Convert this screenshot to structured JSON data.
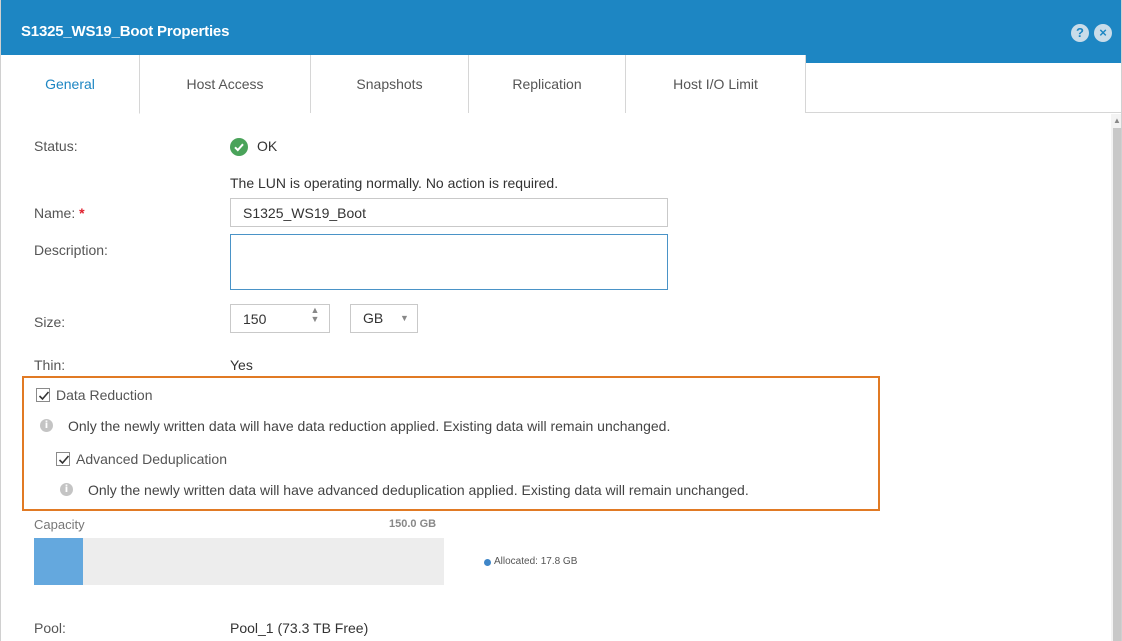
{
  "window": {
    "title": "S1325_WS19_Boot Properties",
    "help_glyph": "?",
    "close_glyph": "×",
    "accent_color": "#1d86c3"
  },
  "tabs": [
    {
      "label": "General",
      "active": true
    },
    {
      "label": "Host Access",
      "active": false
    },
    {
      "label": "Snapshots",
      "active": false
    },
    {
      "label": "Replication",
      "active": false
    },
    {
      "label": "Host I/O Limit",
      "active": false
    }
  ],
  "general": {
    "status_label": "Status:",
    "status_value": "OK",
    "status_message": "The LUN is operating normally. No action is required.",
    "name_label": "Name:",
    "name_required": "*",
    "name_value": "S1325_WS19_Boot",
    "description_label": "Description:",
    "description_value": "",
    "size_label": "Size:",
    "size_value": "150",
    "size_unit": "GB",
    "thin_label": "Thin:",
    "thin_value": "Yes"
  },
  "data_reduction": {
    "checked": true,
    "label": "Data Reduction",
    "info": "Only the newly written data will have data reduction applied. Existing data will remain unchanged.",
    "advanced_dedup": {
      "checked": true,
      "label": "Advanced Deduplication",
      "info": "Only the newly written data will have advanced deduplication applied. Existing data will remain unchanged."
    },
    "highlight_color": "#e17a24"
  },
  "capacity": {
    "label": "Capacity",
    "total": "150.0 GB",
    "allocated_legend": "Allocated: 17.8 GB",
    "allocated_fraction": 0.1187,
    "fill_color": "#64a8de"
  },
  "pool": {
    "label": "Pool:",
    "value": "Pool_1 (73.3 TB Free)"
  }
}
